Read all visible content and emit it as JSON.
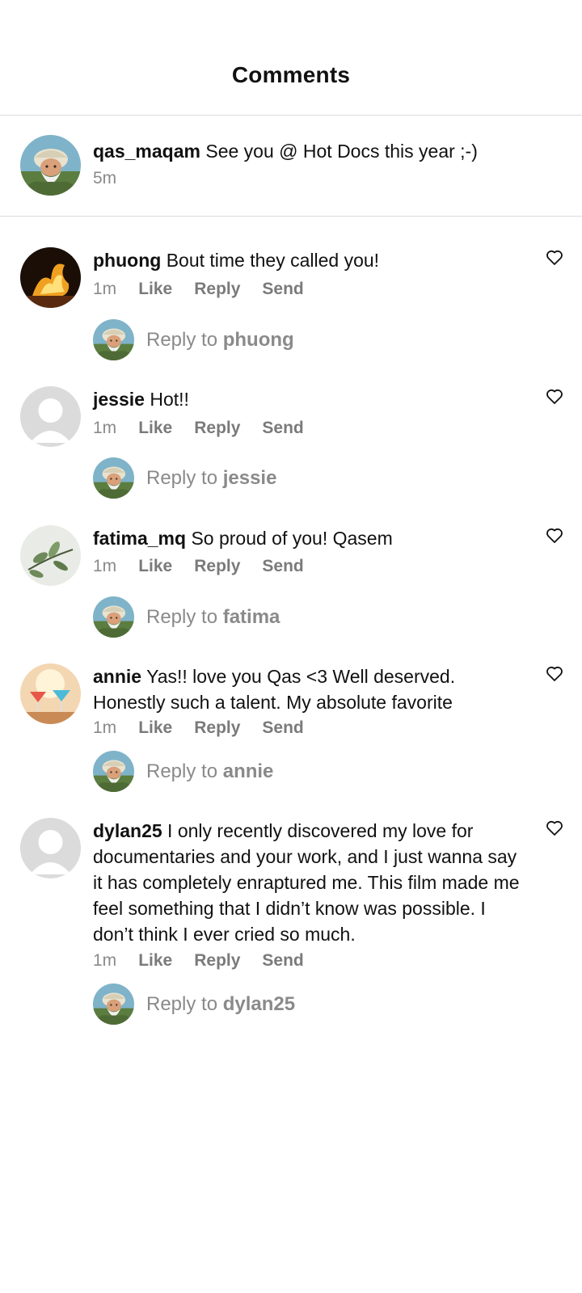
{
  "header": {
    "title": "Comments"
  },
  "caption": {
    "username": "qas_maqam",
    "text": "See you @ Hot Docs this year ;-)",
    "time": "5m"
  },
  "actions": {
    "like": "Like",
    "reply": "Reply",
    "send": "Send"
  },
  "reply_prefix": "Reply to",
  "comments": [
    {
      "username": "phuong",
      "text": "Bout time they called you!",
      "time": "1m",
      "reply_target": "phuong",
      "avatar": "fire-avatar"
    },
    {
      "username": "jessie",
      "text": "Hot!!",
      "time": "1m",
      "reply_target": "jessie",
      "avatar": "default-avatar"
    },
    {
      "username": "fatima_mq",
      "text": "So proud of you! Qasem",
      "time": "1m",
      "reply_target": "fatima",
      "avatar": "plant-avatar"
    },
    {
      "username": "annie",
      "text": "Yas!! love you Qas <3 Well deserved. Honestly such a talent. My absolute favorite",
      "time": "1m",
      "reply_target": "annie",
      "avatar": "drinks-avatar"
    },
    {
      "username": "dylan25",
      "text": "I only recently discovered my love for documentaries and your work, and I just wanna say it has completely enraptured me. This film made me feel something that I didn’t know was possible. I don’t think I ever cried so much.",
      "time": "1m",
      "reply_target": "dylan25",
      "avatar": "default-avatar"
    }
  ],
  "colors": {
    "muted": "#8a8a8a",
    "divider": "#dcdcdc",
    "text": "#111111"
  }
}
